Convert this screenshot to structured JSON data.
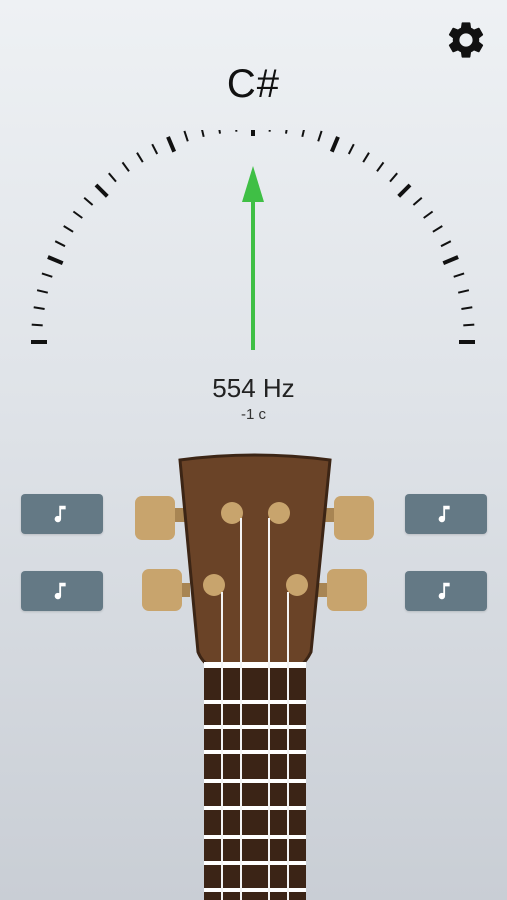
{
  "tuner": {
    "note": "C#",
    "frequency": "554 Hz",
    "cents": "-1 c",
    "cents_value": -1
  },
  "icons": {
    "settings": "gear-icon",
    "play": "music-note-icon"
  },
  "strings": [
    {
      "position": "upper-left"
    },
    {
      "position": "lower-left"
    },
    {
      "position": "upper-right"
    },
    {
      "position": "lower-right"
    }
  ],
  "colors": {
    "needle": "#3fbf45",
    "button": "#647985",
    "headstock": "#6a4327",
    "pegs": "#c8a46d",
    "fretboard": "#3b2416"
  }
}
